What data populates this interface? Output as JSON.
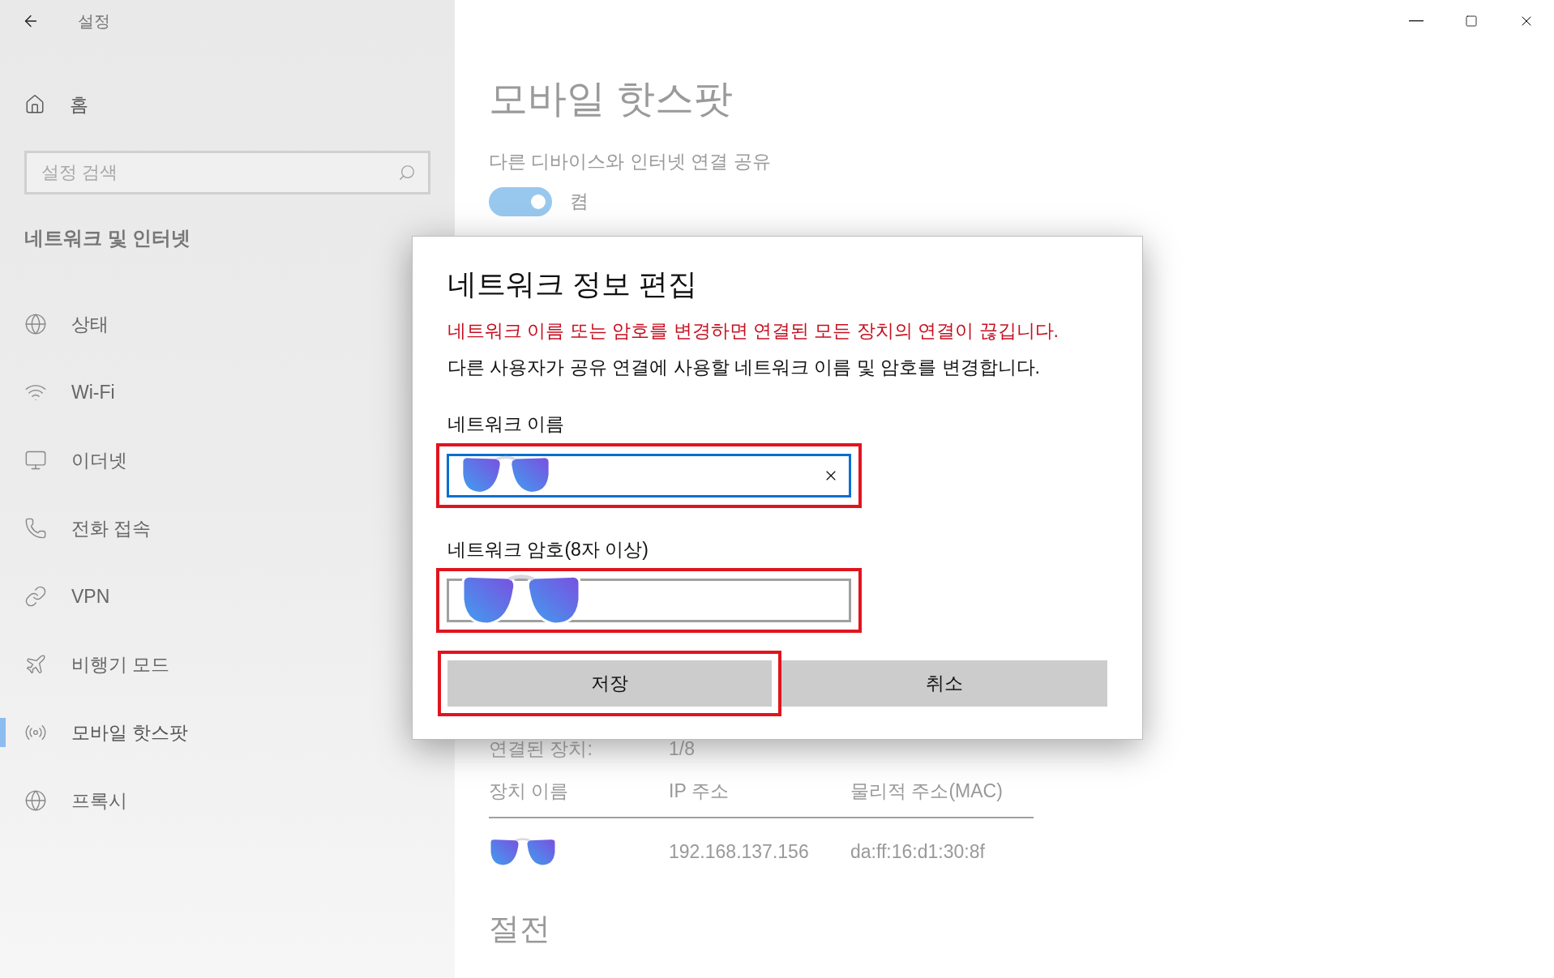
{
  "window": {
    "title": "설정"
  },
  "sidebar": {
    "home": "홈",
    "search": {
      "placeholder": "설정 검색"
    },
    "section": "네트워크 및 인터넷",
    "items": [
      {
        "label": "상태",
        "kind": "status",
        "selected": false
      },
      {
        "label": "Wi-Fi",
        "kind": "wifi",
        "selected": false
      },
      {
        "label": "이더넷",
        "kind": "ethernet",
        "selected": false
      },
      {
        "label": "전화 접속",
        "kind": "dialup",
        "selected": false
      },
      {
        "label": "VPN",
        "kind": "vpn",
        "selected": false
      },
      {
        "label": "비행기 모드",
        "kind": "airplane",
        "selected": false
      },
      {
        "label": "모바일 핫스팟",
        "kind": "hotspot",
        "selected": true
      },
      {
        "label": "프록시",
        "kind": "proxy",
        "selected": false
      }
    ]
  },
  "page": {
    "title": "모바일 핫스팟",
    "share_label": "다른 디바이스와 인터넷 연결 공유",
    "toggle": {
      "on": true,
      "label": "켬"
    },
    "connected_label": "연결된 장치:",
    "connected_value": "1/8",
    "table": {
      "columns": [
        "장치 이름",
        "IP 주소",
        "물리적 주소(MAC)"
      ],
      "rows": [
        {
          "ip": "192.168.137.156",
          "mac": "da:ff:16:d1:30:8f"
        }
      ]
    },
    "power_title": "절전"
  },
  "dialog": {
    "title": "네트워크 정보 편집",
    "warning": "네트워크 이름 또는 암호를 변경하면 연결된 모든 장치의 연결이 끊깁니다.",
    "description": "다른 사용자가 공유 연결에 사용할 네트워크 이름 및 암호를 변경합니다.",
    "fields": [
      {
        "label": "네트워크 이름",
        "focused": true,
        "highlighted": true
      },
      {
        "label": "네트워크 암호(8자 이상)",
        "focused": false,
        "highlighted": true
      }
    ],
    "buttons": [
      {
        "label": "저장",
        "highlighted": true
      },
      {
        "label": "취소",
        "highlighted": false
      }
    ]
  }
}
